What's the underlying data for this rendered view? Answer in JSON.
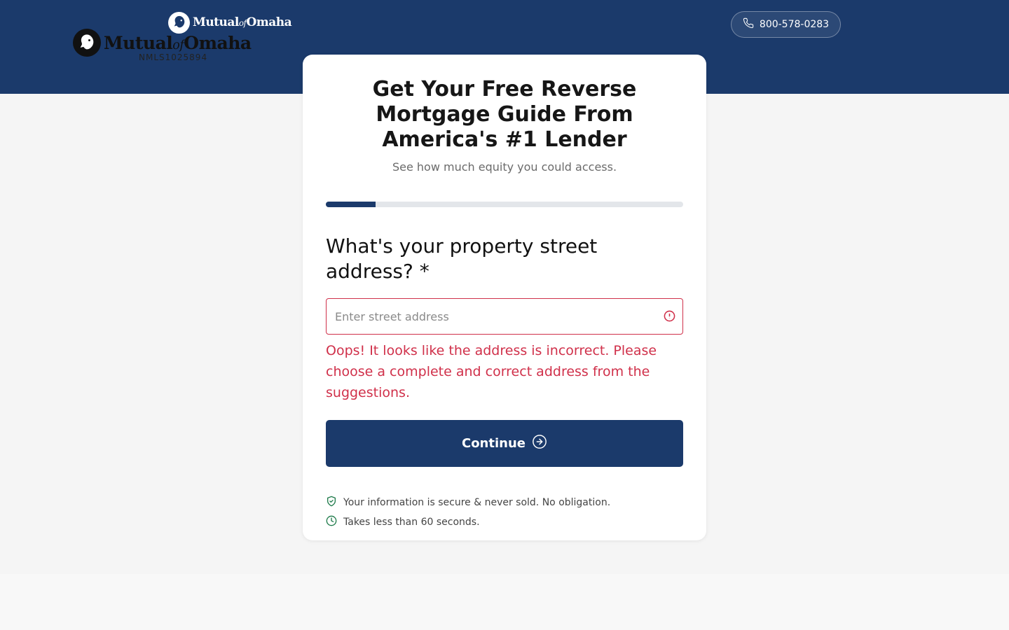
{
  "brand": {
    "part1": "Mutual",
    "of": "of",
    "part2": "Omaha"
  },
  "header": {
    "phone": "800-578-0283"
  },
  "card": {
    "title": "Get Your Free Reverse Mortgage Guide From America's #1 Lender",
    "subtitle": "See how much equity you could access.",
    "progress_fraction": 0.14,
    "question": "What's your property street address? *",
    "address": {
      "value": "",
      "placeholder": "Enter street address"
    },
    "error": "Oops! It looks like the address is incorrect. Please choose a complete and correct address from the suggestions.",
    "continue_label": "Continue",
    "trust": [
      {
        "icon": "shield-check-icon",
        "text": "Your information is secure & never sold. No obligation."
      },
      {
        "icon": "clock-icon",
        "text": "Takes less than 60 seconds."
      }
    ]
  },
  "footer": {
    "nmls": "NMLS1025894"
  },
  "colors": {
    "brand_navy": "#1b3a6b",
    "error_red": "#d0304a",
    "trust_green": "#1e7a4a"
  }
}
